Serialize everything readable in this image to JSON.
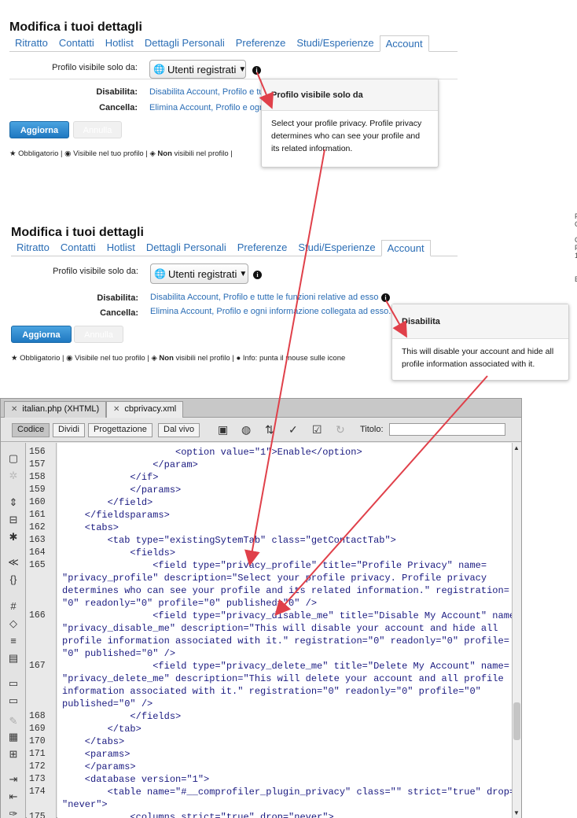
{
  "panel1": {
    "title": "Modifica i tuoi dettagli",
    "tabs": [
      "Ritratto",
      "Contatti",
      "Hotlist",
      "Dettagli Personali",
      "Preferenze",
      "Studi/Esperienze",
      "Account"
    ],
    "privacy_label": "Profilo visibile solo da:",
    "privacy_select": "Utenti registrati",
    "disable_label": "Disabilita:",
    "disable_link": "Disabilita Account, Profilo e tu",
    "delete_label": "Cancella:",
    "delete_link": "Elimina Account, Profilo e ogni",
    "update_button": "Aggiorna",
    "cancel_button": "Annulla",
    "legend": {
      "required": "Obbligatorio |",
      "visible": "Visibile nel tuo profilo |",
      "non": "Non",
      "not_visible": "visibili nel profilo |"
    },
    "tooltip": {
      "title": "Profilo visibile solo da",
      "body": "Select your profile privacy. Profile privacy determines who can see your profile and its related information."
    }
  },
  "panel2": {
    "title": "Modifica i tuoi dettagli",
    "tabs": [
      "Ritratto",
      "Contatti",
      "Hotlist",
      "Dettagli Personali",
      "Preferenze",
      "Studi/Esperienze",
      "Account"
    ],
    "privacy_label": "Profilo visibile solo da:",
    "privacy_select": "Utenti registrati",
    "disable_label": "Disabilita:",
    "disable_link": "Disabilita Account, Profilo e tutte le funzioni relative ad esso",
    "delete_label": "Cancella:",
    "delete_link": "Elimina Account, Profilo e ogni informazione collegata ad esso.",
    "update_button": "Aggiorna",
    "cancel_button": "Annulla",
    "legend": {
      "required": "Obbligatorio |",
      "visible": "Visibile nel tuo profilo |",
      "non": "Non",
      "not_visible": "visibili nel profilo |",
      "info": "Info: punta il mouse sulle icone"
    },
    "tooltip": {
      "title": "Disabilita",
      "body": "This will disable your account and hide all profile information associated with it."
    }
  },
  "editor": {
    "tabs": [
      {
        "label": "italian.php (XHTML)"
      },
      {
        "label": "cbprivacy.xml"
      }
    ],
    "views": [
      "Codice",
      "Dividi",
      "Progettazione",
      "Dal vivo"
    ],
    "title_label": "Titolo:",
    "lines": [
      {
        "n": "156",
        "t": "                    <option value=\"1\">Enable</option>"
      },
      {
        "n": "157",
        "t": "                </param>"
      },
      {
        "n": "158",
        "t": "            </if>"
      },
      {
        "n": "159",
        "t": "            </params>"
      },
      {
        "n": "160",
        "t": "        </field>"
      },
      {
        "n": "161",
        "t": "    </fieldsparams>"
      },
      {
        "n": "162",
        "t": "    <tabs>"
      },
      {
        "n": "163",
        "t": "        <tab type=\"existingSytemTab\" class=\"getContactTab\">"
      },
      {
        "n": "164",
        "t": "            <fields>"
      },
      {
        "n": "165",
        "t": "                <field type=\"privacy_profile\" title=\"Profile Privacy\" name="
      },
      {
        "n": "",
        "t": "\"privacy_profile\" description=\"Select your profile privacy. Profile privacy"
      },
      {
        "n": "",
        "t": "determines who can see your profile and its related information.\" registration="
      },
      {
        "n": "",
        "t": "\"0\" readonly=\"0\" profile=\"0\" published=\"0\" />"
      },
      {
        "n": "166",
        "t": "                <field type=\"privacy_disable_me\" title=\"Disable My Account\" name="
      },
      {
        "n": "",
        "t": "\"privacy_disable_me\" description=\"This will disable your account and hide all"
      },
      {
        "n": "",
        "t": "profile information associated with it.\" registration=\"0\" readonly=\"0\" profile="
      },
      {
        "n": "",
        "t": "\"0\" published=\"0\" />"
      },
      {
        "n": "167",
        "t": "                <field type=\"privacy_delete_me\" title=\"Delete My Account\" name="
      },
      {
        "n": "",
        "t": "\"privacy_delete_me\" description=\"This will delete your account and all profile"
      },
      {
        "n": "",
        "t": "information associated with it.\" registration=\"0\" readonly=\"0\" profile=\"0\""
      },
      {
        "n": "",
        "t": "published=\"0\" />"
      },
      {
        "n": "168",
        "t": "            </fields>"
      },
      {
        "n": "169",
        "t": "        </tab>"
      },
      {
        "n": "170",
        "t": "    </tabs>"
      },
      {
        "n": "171",
        "t": "    <params>"
      },
      {
        "n": "172",
        "t": "    </params>"
      },
      {
        "n": "173",
        "t": "    <database version=\"1\">"
      },
      {
        "n": "174",
        "t": "        <table name=\"#__comprofiler_plugin_privacy\" class=\"\" strict=\"true\" drop="
      },
      {
        "n": "",
        "t": "\"never\">"
      },
      {
        "n": "175",
        "t": "            <columns strict=\"true\" drop=\"never\">"
      }
    ]
  },
  "colors": {
    "link": "#2a6db5",
    "arrow": "#e0404a",
    "button": "#1f78c1"
  }
}
